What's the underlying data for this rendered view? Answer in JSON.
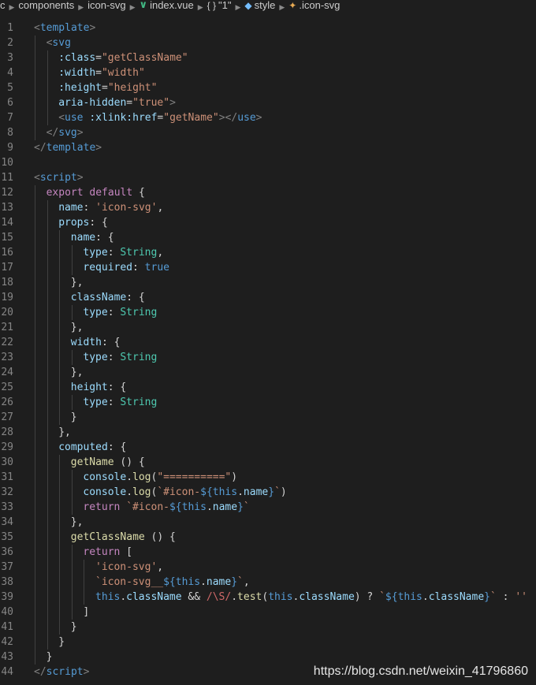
{
  "breadcrumb": {
    "items": [
      {
        "label": "c",
        "icon": ""
      },
      {
        "label": "components",
        "icon": ""
      },
      {
        "label": "icon-svg",
        "icon": ""
      },
      {
        "label": "index.vue",
        "icon": "vue-icon"
      },
      {
        "label": "\"1\"",
        "icon": "braces-icon"
      },
      {
        "label": "style",
        "icon": "cube-icon"
      },
      {
        "label": ".icon-svg",
        "icon": "style-icon"
      }
    ]
  },
  "editor": {
    "lines": [
      {
        "n": "1",
        "indent": 0,
        "tokens": [
          [
            "punct",
            "<"
          ],
          [
            "tag",
            "template"
          ],
          [
            "punct",
            ">"
          ]
        ]
      },
      {
        "n": "2",
        "indent": 1,
        "tokens": [
          [
            "punct",
            "<"
          ],
          [
            "tag",
            "svg"
          ]
        ]
      },
      {
        "n": "3",
        "indent": 2,
        "tokens": [
          [
            "attr",
            ":class"
          ],
          [
            "plain",
            "="
          ],
          [
            "str",
            "\"getClassName\""
          ]
        ]
      },
      {
        "n": "4",
        "indent": 2,
        "tokens": [
          [
            "attr",
            ":width"
          ],
          [
            "plain",
            "="
          ],
          [
            "str",
            "\"width\""
          ]
        ]
      },
      {
        "n": "5",
        "indent": 2,
        "tokens": [
          [
            "attr",
            ":height"
          ],
          [
            "plain",
            "="
          ],
          [
            "str",
            "\"height\""
          ]
        ]
      },
      {
        "n": "6",
        "indent": 2,
        "tokens": [
          [
            "attr",
            "aria-hidden"
          ],
          [
            "plain",
            "="
          ],
          [
            "str",
            "\"true\""
          ],
          [
            "punct",
            ">"
          ]
        ]
      },
      {
        "n": "7",
        "indent": 2,
        "tokens": [
          [
            "punct",
            "<"
          ],
          [
            "tag",
            "use"
          ],
          [
            "plain",
            " "
          ],
          [
            "attr",
            ":xlink:href"
          ],
          [
            "plain",
            "="
          ],
          [
            "str",
            "\"getName\""
          ],
          [
            "punct",
            "></"
          ],
          [
            "tag",
            "use"
          ],
          [
            "punct",
            ">"
          ]
        ]
      },
      {
        "n": "8",
        "indent": 1,
        "tokens": [
          [
            "punct",
            "</"
          ],
          [
            "tag",
            "svg"
          ],
          [
            "punct",
            ">"
          ]
        ]
      },
      {
        "n": "9",
        "indent": 0,
        "tokens": [
          [
            "punct",
            "</"
          ],
          [
            "tag",
            "template"
          ],
          [
            "punct",
            ">"
          ]
        ]
      },
      {
        "n": "10",
        "indent": 0,
        "tokens": []
      },
      {
        "n": "11",
        "indent": 0,
        "tokens": [
          [
            "punct",
            "<"
          ],
          [
            "tag",
            "script"
          ],
          [
            "punct",
            ">"
          ]
        ]
      },
      {
        "n": "12",
        "indent": 1,
        "tokens": [
          [
            "kw",
            "export"
          ],
          [
            "plain",
            " "
          ],
          [
            "kw",
            "default"
          ],
          [
            "plain",
            " {"
          ]
        ]
      },
      {
        "n": "13",
        "indent": 2,
        "tokens": [
          [
            "prop",
            "name"
          ],
          [
            "plain",
            ": "
          ],
          [
            "str",
            "'icon-svg'"
          ],
          [
            "plain",
            ","
          ]
        ]
      },
      {
        "n": "14",
        "indent": 2,
        "tokens": [
          [
            "prop",
            "props"
          ],
          [
            "plain",
            ": {"
          ]
        ]
      },
      {
        "n": "15",
        "indent": 3,
        "tokens": [
          [
            "prop",
            "name"
          ],
          [
            "plain",
            ": {"
          ]
        ]
      },
      {
        "n": "16",
        "indent": 4,
        "tokens": [
          [
            "prop",
            "type"
          ],
          [
            "plain",
            ": "
          ],
          [
            "type",
            "String"
          ],
          [
            "plain",
            ","
          ]
        ]
      },
      {
        "n": "17",
        "indent": 4,
        "tokens": [
          [
            "prop",
            "required"
          ],
          [
            "plain",
            ": "
          ],
          [
            "blue",
            "true"
          ]
        ]
      },
      {
        "n": "18",
        "indent": 3,
        "tokens": [
          [
            "plain",
            "},"
          ]
        ]
      },
      {
        "n": "19",
        "indent": 3,
        "tokens": [
          [
            "prop",
            "className"
          ],
          [
            "plain",
            ": {"
          ]
        ]
      },
      {
        "n": "20",
        "indent": 4,
        "tokens": [
          [
            "prop",
            "type"
          ],
          [
            "plain",
            ": "
          ],
          [
            "type",
            "String"
          ]
        ]
      },
      {
        "n": "21",
        "indent": 3,
        "tokens": [
          [
            "plain",
            "},"
          ]
        ]
      },
      {
        "n": "22",
        "indent": 3,
        "tokens": [
          [
            "prop",
            "width"
          ],
          [
            "plain",
            ": {"
          ]
        ]
      },
      {
        "n": "23",
        "indent": 4,
        "tokens": [
          [
            "prop",
            "type"
          ],
          [
            "plain",
            ": "
          ],
          [
            "type",
            "String"
          ]
        ]
      },
      {
        "n": "24",
        "indent": 3,
        "tokens": [
          [
            "plain",
            "},"
          ]
        ]
      },
      {
        "n": "25",
        "indent": 3,
        "tokens": [
          [
            "prop",
            "height"
          ],
          [
            "plain",
            ": {"
          ]
        ]
      },
      {
        "n": "26",
        "indent": 4,
        "tokens": [
          [
            "prop",
            "type"
          ],
          [
            "plain",
            ": "
          ],
          [
            "type",
            "String"
          ]
        ]
      },
      {
        "n": "27",
        "indent": 3,
        "tokens": [
          [
            "plain",
            "}"
          ]
        ]
      },
      {
        "n": "28",
        "indent": 2,
        "tokens": [
          [
            "plain",
            "},"
          ]
        ]
      },
      {
        "n": "29",
        "indent": 2,
        "tokens": [
          [
            "prop",
            "computed"
          ],
          [
            "plain",
            ": {"
          ]
        ]
      },
      {
        "n": "30",
        "indent": 3,
        "tokens": [
          [
            "fn",
            "getName"
          ],
          [
            "plain",
            " () {"
          ]
        ]
      },
      {
        "n": "31",
        "indent": 4,
        "tokens": [
          [
            "prop",
            "console"
          ],
          [
            "plain",
            "."
          ],
          [
            "fn",
            "log"
          ],
          [
            "plain",
            "("
          ],
          [
            "str",
            "\"==========\""
          ],
          [
            "plain",
            ")"
          ]
        ]
      },
      {
        "n": "32",
        "indent": 4,
        "tokens": [
          [
            "prop",
            "console"
          ],
          [
            "plain",
            "."
          ],
          [
            "fn",
            "log"
          ],
          [
            "plain",
            "("
          ],
          [
            "str",
            "`#icon-"
          ],
          [
            "blue",
            "${"
          ],
          [
            "blue",
            "this"
          ],
          [
            "plain",
            "."
          ],
          [
            "prop",
            "name"
          ],
          [
            "blue",
            "}"
          ],
          [
            "str",
            "`"
          ],
          [
            "plain",
            ")"
          ]
        ]
      },
      {
        "n": "33",
        "indent": 4,
        "tokens": [
          [
            "kw",
            "return"
          ],
          [
            "plain",
            " "
          ],
          [
            "str",
            "`#icon-"
          ],
          [
            "blue",
            "${"
          ],
          [
            "blue",
            "this"
          ],
          [
            "plain",
            "."
          ],
          [
            "prop",
            "name"
          ],
          [
            "blue",
            "}"
          ],
          [
            "str",
            "`"
          ]
        ]
      },
      {
        "n": "34",
        "indent": 3,
        "tokens": [
          [
            "plain",
            "},"
          ]
        ]
      },
      {
        "n": "35",
        "indent": 3,
        "tokens": [
          [
            "fn",
            "getClassName"
          ],
          [
            "plain",
            " () {"
          ]
        ]
      },
      {
        "n": "36",
        "indent": 4,
        "tokens": [
          [
            "kw",
            "return"
          ],
          [
            "plain",
            " ["
          ]
        ]
      },
      {
        "n": "37",
        "indent": 5,
        "tokens": [
          [
            "str",
            "'icon-svg'"
          ],
          [
            "plain",
            ","
          ]
        ]
      },
      {
        "n": "38",
        "indent": 5,
        "tokens": [
          [
            "str",
            "`icon-svg__"
          ],
          [
            "blue",
            "${"
          ],
          [
            "blue",
            "this"
          ],
          [
            "plain",
            "."
          ],
          [
            "prop",
            "name"
          ],
          [
            "blue",
            "}"
          ],
          [
            "str",
            "`"
          ],
          [
            "plain",
            ","
          ]
        ]
      },
      {
        "n": "39",
        "indent": 5,
        "tokens": [
          [
            "blue",
            "this"
          ],
          [
            "plain",
            "."
          ],
          [
            "prop",
            "className"
          ],
          [
            "plain",
            " && "
          ],
          [
            "regex",
            "/\\S/"
          ],
          [
            "plain",
            "."
          ],
          [
            "fn",
            "test"
          ],
          [
            "plain",
            "("
          ],
          [
            "blue",
            "this"
          ],
          [
            "plain",
            "."
          ],
          [
            "prop",
            "className"
          ],
          [
            "plain",
            ") ? "
          ],
          [
            "str",
            "`"
          ],
          [
            "blue",
            "${"
          ],
          [
            "blue",
            "this"
          ],
          [
            "plain",
            "."
          ],
          [
            "prop",
            "className"
          ],
          [
            "blue",
            "}"
          ],
          [
            "str",
            "`"
          ],
          [
            "plain",
            " : "
          ],
          [
            "str",
            "''"
          ]
        ]
      },
      {
        "n": "40",
        "indent": 4,
        "tokens": [
          [
            "plain",
            "]"
          ]
        ]
      },
      {
        "n": "41",
        "indent": 3,
        "tokens": [
          [
            "plain",
            "}"
          ]
        ]
      },
      {
        "n": "42",
        "indent": 2,
        "tokens": [
          [
            "plain",
            "}"
          ]
        ]
      },
      {
        "n": "43",
        "indent": 1,
        "tokens": [
          [
            "plain",
            "}"
          ]
        ]
      },
      {
        "n": "44",
        "indent": 0,
        "tokens": [
          [
            "punct",
            "</"
          ],
          [
            "tag",
            "script"
          ],
          [
            "punct",
            ">"
          ]
        ]
      }
    ]
  },
  "watermark": {
    "text": "https://blog.csdn.net/weixin_41796860"
  },
  "colors": {
    "background": "#1e1e1e",
    "tag": "#569cd6",
    "attribute": "#9cdcfe",
    "string": "#ce9178",
    "keyword": "#c586c0",
    "type": "#4ec9b0",
    "function": "#dcdcaa",
    "line_number": "#858585"
  }
}
